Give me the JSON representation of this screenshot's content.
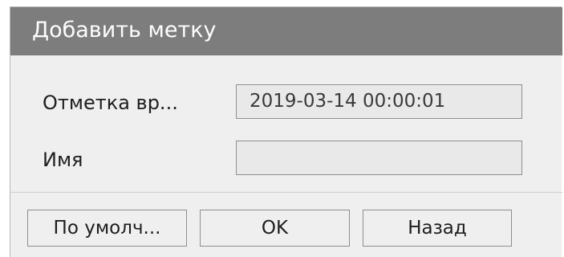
{
  "dialog": {
    "title": "Добавить метку",
    "fields": {
      "time_label": "Отметка вр...",
      "time_value": "2019-03-14 00:00:01",
      "name_label": "Имя",
      "name_value": ""
    },
    "buttons": {
      "default_label": "По умолч...",
      "ok_label": "OK",
      "back_label": "Назад"
    }
  },
  "colors": {
    "titlebar": "#7d7d7d",
    "dialog_background": "#efefef",
    "field_background": "#e9e9e9",
    "border": "#8f8f8f"
  }
}
